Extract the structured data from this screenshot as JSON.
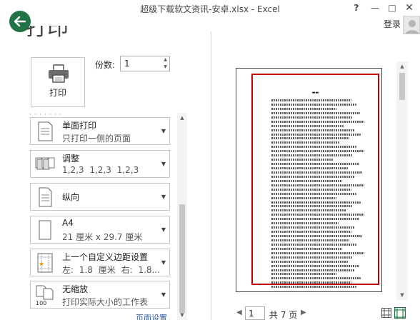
{
  "window": {
    "title": "超级下载软文资讯-安卓.xlsx - Excel",
    "help": "?",
    "minimize": "—",
    "maximize": "□",
    "close": "✕",
    "login": "登录"
  },
  "backstage": {
    "heading": "打印"
  },
  "print": {
    "button_label": "打印",
    "copies_label": "份数:",
    "copies_value": "1"
  },
  "settings": [
    {
      "icon": "single-sided-icon",
      "title": "单面打印",
      "subtitle": "只打印一侧的页面"
    },
    {
      "icon": "collated-icon",
      "title": "调整",
      "subtitle": "1,2,3    1,2,3    1,2,3"
    },
    {
      "icon": "portrait-icon",
      "title": "纵向",
      "subtitle": ""
    },
    {
      "icon": "paper-size-icon",
      "title": "A4",
      "subtitle": "21 厘米 x 29.7 厘米"
    },
    {
      "icon": "margins-icon",
      "title": "上一个自定义边距设置",
      "subtitle": "左: 1.8 厘米    右: 1.8..."
    },
    {
      "icon": "no-scaling-icon",
      "title": "无缩放",
      "subtitle": "打印实际大小的工作表"
    }
  ],
  "page_setup_link": "页面设置",
  "navigation": {
    "current_page": "1",
    "total_pages": "共 7 页"
  },
  "colors": {
    "accent": "#217346",
    "preview_border": "#c00000",
    "link": "#2b579a"
  }
}
